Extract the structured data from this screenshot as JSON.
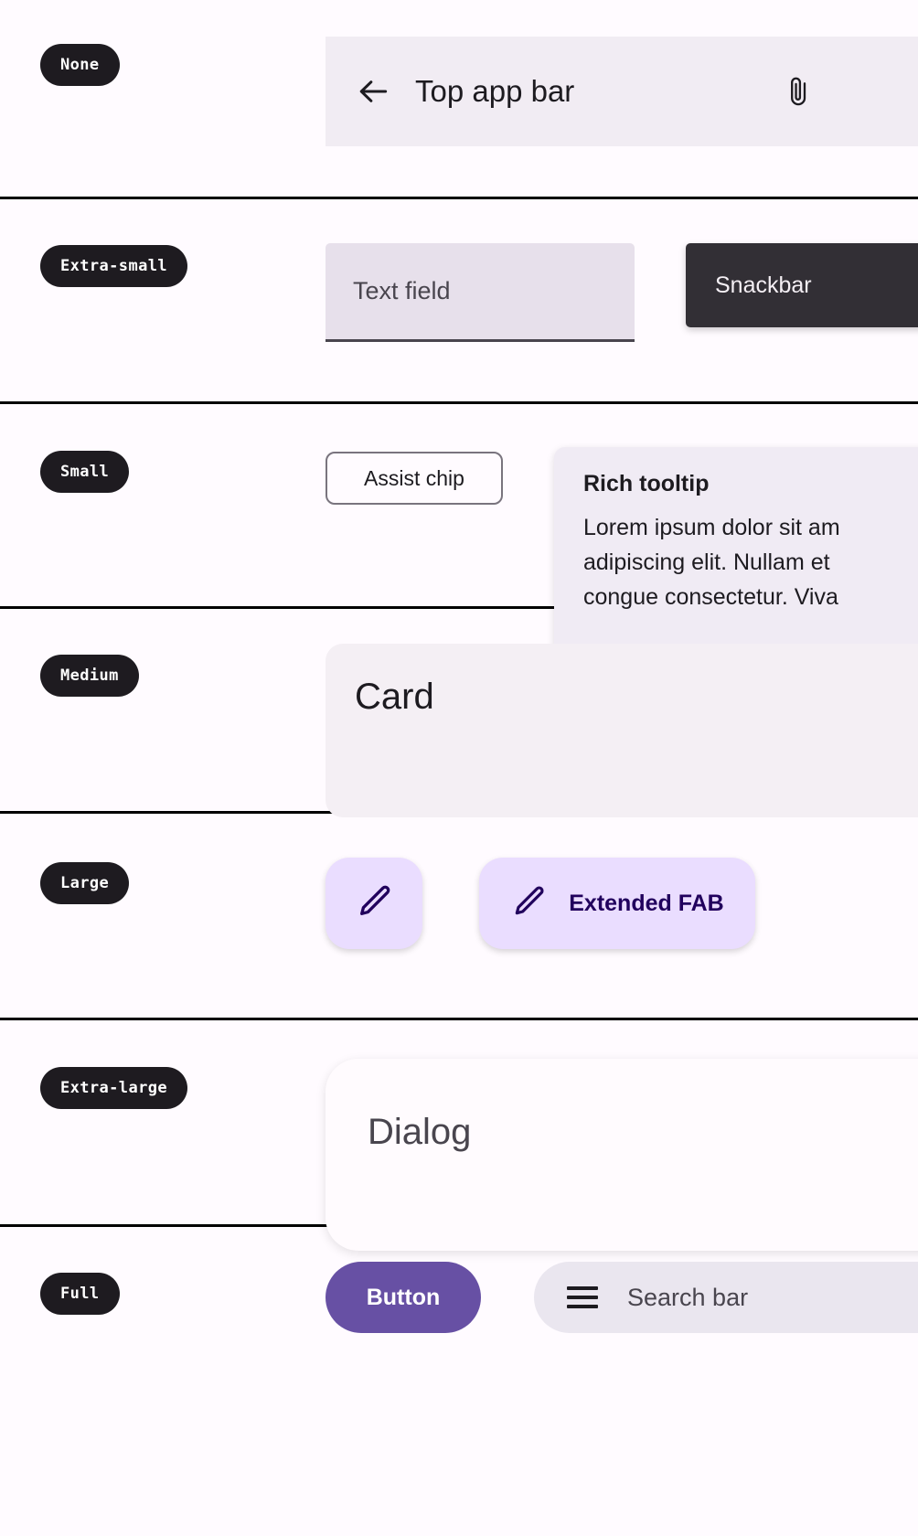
{
  "theme": {
    "background": "#FFFBFF",
    "divider": "#000000",
    "token_chip_bg": "#1E1B20",
    "token_chip_fg": "#FFFFFF",
    "surface_container": "#F1ECF3",
    "text_field_bg": "#E7E0EB",
    "snackbar_bg": "#322F35",
    "tooltip_bg": "#F0EBF4",
    "card_bg": "#F4EFF4",
    "fab_bg": "#EADDFF",
    "fab_fg": "#21005D",
    "dialog_bg": "#FFFBFE",
    "button_bg": "#6750A4",
    "button_fg": "#FFFFFF",
    "search_bar_bg": "#EAE6EF",
    "on_surface": "#1D1B20",
    "on_surface_variant": "#49454E",
    "outline": "#79747E"
  },
  "rows": [
    {
      "token": "None",
      "components": {
        "top_app_bar": {
          "title": "Top app bar",
          "back_icon": "arrow-back-icon",
          "trailing_icon": "attachment-icon"
        }
      }
    },
    {
      "token": "Extra-small",
      "components": {
        "text_field": {
          "label": "Text field"
        },
        "snackbar": {
          "text": "Snackbar"
        }
      }
    },
    {
      "token": "Small",
      "components": {
        "assist_chip": {
          "label": "Assist chip"
        },
        "rich_tooltip": {
          "title": "Rich tooltip",
          "lines": [
            "Lorem ipsum dolor sit am",
            "adipiscing elit. Nullam et",
            "congue consectetur. Viva"
          ]
        }
      }
    },
    {
      "token": "Medium",
      "components": {
        "card": {
          "title": "Card"
        }
      }
    },
    {
      "token": "Large",
      "components": {
        "fab": {
          "icon": "pencil-icon"
        },
        "extended_fab": {
          "icon": "pencil-icon",
          "label": "Extended FAB"
        }
      }
    },
    {
      "token": "Extra-large",
      "components": {
        "dialog": {
          "title": "Dialog"
        }
      }
    },
    {
      "token": "Full",
      "components": {
        "button": {
          "label": "Button"
        },
        "search_bar": {
          "placeholder": "Search bar",
          "leading_icon": "hamburger-menu-icon"
        }
      }
    }
  ]
}
